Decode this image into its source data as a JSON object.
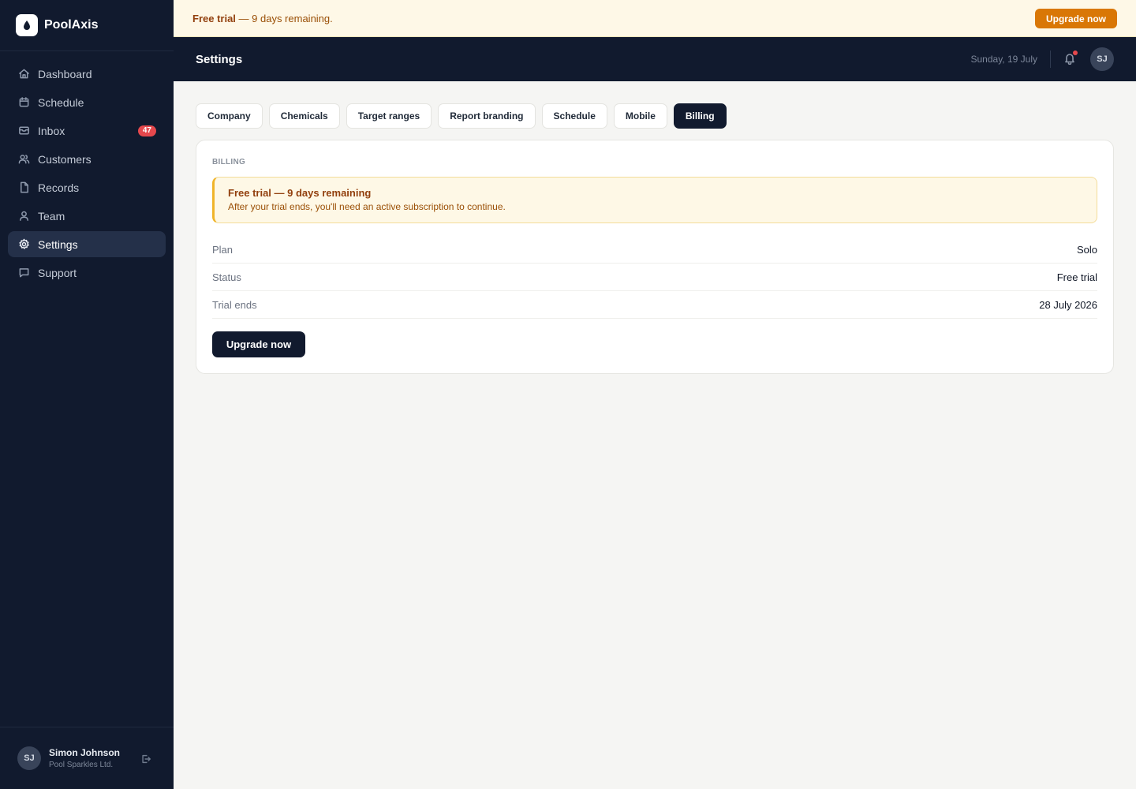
{
  "app": {
    "name": "PoolAxis"
  },
  "sidebar": {
    "items": [
      {
        "label": "Dashboard",
        "icon": "home-icon"
      },
      {
        "label": "Schedule",
        "icon": "calendar-icon"
      },
      {
        "label": "Inbox",
        "icon": "inbox-icon",
        "badge": "47"
      },
      {
        "label": "Customers",
        "icon": "users-icon"
      },
      {
        "label": "Records",
        "icon": "file-icon"
      },
      {
        "label": "Team",
        "icon": "user-icon"
      },
      {
        "label": "Settings",
        "icon": "gear-icon",
        "active": true
      },
      {
        "label": "Support",
        "icon": "chat-icon"
      }
    ],
    "user": {
      "initials": "SJ",
      "name": "Simon Johnson",
      "org": "Pool Sparkles Ltd."
    }
  },
  "banner": {
    "strong": "Free trial",
    "text": " — 9 days remaining.",
    "button": "Upgrade now"
  },
  "header": {
    "title": "Settings",
    "date": "Sunday, 19 July",
    "avatar_initials": "SJ"
  },
  "tabs": [
    {
      "label": "Company"
    },
    {
      "label": "Chemicals"
    },
    {
      "label": "Target ranges"
    },
    {
      "label": "Report branding"
    },
    {
      "label": "Schedule"
    },
    {
      "label": "Mobile"
    },
    {
      "label": "Billing",
      "active": true
    }
  ],
  "billing": {
    "section_label": "BILLING",
    "alert_title": "Free trial — 9 days remaining",
    "alert_text": "After your trial ends, you'll need an active subscription to continue.",
    "rows": [
      {
        "label": "Plan",
        "value": "Solo"
      },
      {
        "label": "Status",
        "value": "Free trial"
      },
      {
        "label": "Trial ends",
        "value": "28 July 2026"
      }
    ],
    "button": "Upgrade now"
  },
  "colors": {
    "sidebar_bg": "#111a2e",
    "accent_orange": "#d97706",
    "badge_red": "#e5484d",
    "warning_border": "#f0b429"
  }
}
